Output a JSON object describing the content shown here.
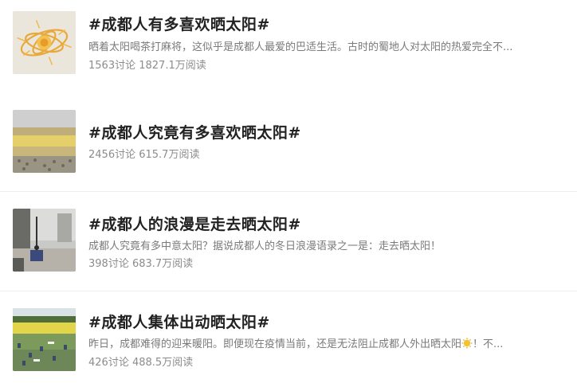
{
  "topics": [
    {
      "title": "#成都人有多喜欢晒太阳#",
      "description": "晒着太阳喝茶打麻将，这似乎是成都人最爱的巴适生活。古时的蜀地人对太阳的热爱完全不...",
      "discussions": "1563讨论",
      "reads": "1827.1万阅读",
      "thumbnail": "sun-art-icon"
    },
    {
      "title": "#成都人究竟有多喜欢晒太阳#",
      "description": "",
      "discussions": "2456讨论",
      "reads": "615.7万阅读",
      "thumbnail": "crowd-photo"
    },
    {
      "title": "#成都人的浪漫是走去晒太阳#",
      "description": "成都人究竟有多中意太阳？据说成都人的冬日浪漫语录之一是：走去晒太阳！",
      "discussions": "398讨论",
      "reads": "683.7万阅读",
      "thumbnail": "street-photo"
    },
    {
      "title": "#成都人集体出动晒太阳#",
      "description_before": "昨日，成都难得的迎来暖阳。即便现在疫情当前，还是无法阻止成都人外出晒太阳",
      "description_after": "！不...",
      "discussions": "426讨论",
      "reads": "488.5万阅读",
      "thumbnail": "park-photo",
      "emoji": "sun-icon"
    }
  ],
  "colors": {
    "title": "#222222",
    "description": "#7a7a7a",
    "meta": "#8c8c8c",
    "sun": "#f2c230"
  }
}
